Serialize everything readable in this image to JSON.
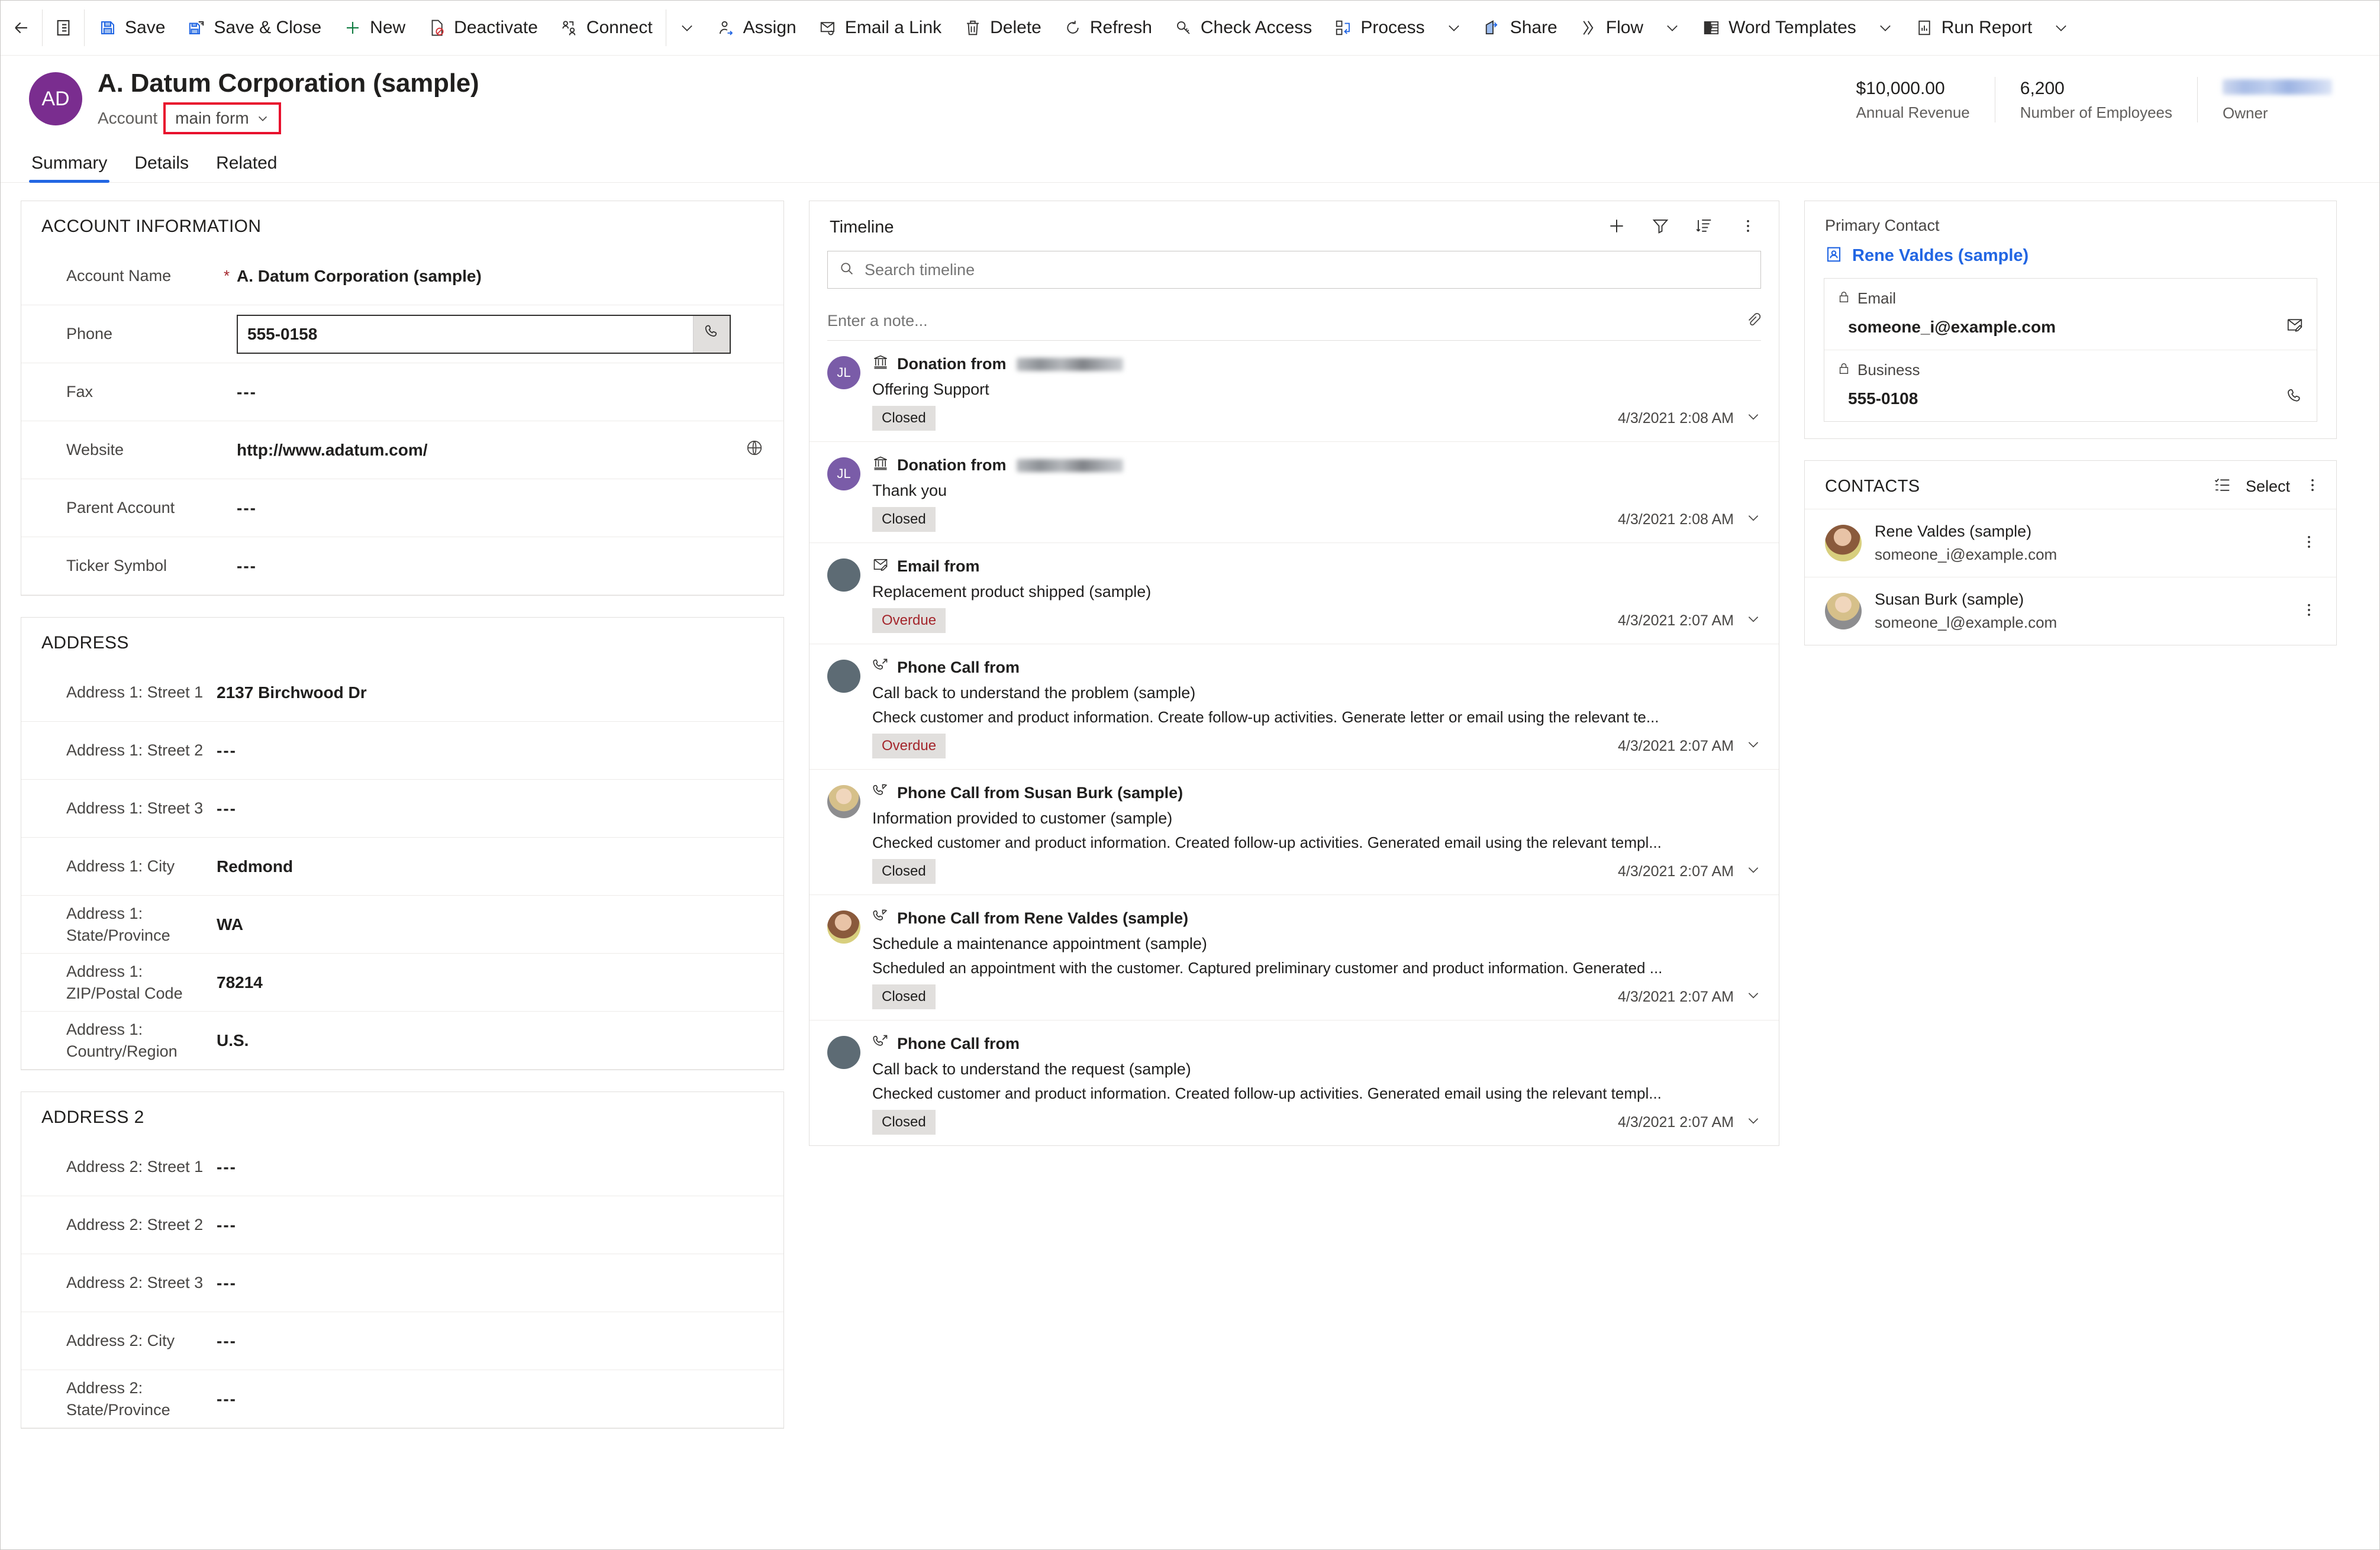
{
  "command_bar": {
    "back_label": "",
    "form_icon_label": "",
    "buttons": [
      {
        "label": "Save",
        "icon": "save-icon"
      },
      {
        "label": "Save & Close",
        "icon": "save-and-close-icon"
      },
      {
        "label": "New",
        "icon": "plus-icon"
      },
      {
        "label": "Deactivate",
        "icon": "deactivate-icon"
      },
      {
        "label": "Connect",
        "icon": "connect-icon",
        "chevron": true
      },
      {
        "label": "Assign",
        "icon": "assign-icon"
      },
      {
        "label": "Email a Link",
        "icon": "email-link-icon"
      },
      {
        "label": "Delete",
        "icon": "trash-icon"
      },
      {
        "label": "Refresh",
        "icon": "refresh-icon"
      },
      {
        "label": "Check Access",
        "icon": "key-icon"
      },
      {
        "label": "Process",
        "icon": "process-icon",
        "chevron": true
      },
      {
        "label": "Share",
        "icon": "share-icon"
      },
      {
        "label": "Flow",
        "icon": "flow-icon",
        "chevron": true
      },
      {
        "label": "Word Templates",
        "icon": "word-icon",
        "chevron": true
      },
      {
        "label": "Run Report",
        "icon": "report-icon",
        "chevron": true
      }
    ]
  },
  "header": {
    "avatar_initials": "AD",
    "title": "A. Datum Corporation (sample)",
    "entity_label": "Account",
    "form_selector": "main form",
    "highlight_color": "#E8112D",
    "metrics": [
      {
        "value": "$10,000.00",
        "label": "Annual Revenue"
      },
      {
        "value": "6,200",
        "label": "Number of Employees"
      },
      {
        "value": "",
        "label": "Owner",
        "redacted": true
      }
    ],
    "tabs": [
      {
        "label": "Summary",
        "active": true
      },
      {
        "label": "Details",
        "active": false
      },
      {
        "label": "Related",
        "active": false
      }
    ]
  },
  "account_information": {
    "title": "ACCOUNT INFORMATION",
    "fields": [
      {
        "label": "Account Name",
        "value": "A. Datum Corporation (sample)",
        "required": true
      },
      {
        "label": "Phone",
        "value": "555-0158",
        "focused": true,
        "trail_icon": "phone-icon"
      },
      {
        "label": "Fax",
        "value": "---"
      },
      {
        "label": "Website",
        "value": "http://www.adatum.com/",
        "trail_icon": "globe-icon"
      },
      {
        "label": "Parent Account",
        "value": "---"
      },
      {
        "label": "Ticker Symbol",
        "value": "---"
      }
    ]
  },
  "address_1": {
    "title": "ADDRESS",
    "fields": [
      {
        "label": "Address 1: Street 1",
        "value": "2137 Birchwood Dr"
      },
      {
        "label": "Address 1: Street 2",
        "value": "---"
      },
      {
        "label": "Address 1: Street 3",
        "value": "---"
      },
      {
        "label": "Address 1: City",
        "value": "Redmond"
      },
      {
        "label": "Address 1: State/Province",
        "value": "WA"
      },
      {
        "label": "Address 1: ZIP/Postal Code",
        "value": "78214"
      },
      {
        "label": "Address 1: Country/Region",
        "value": "U.S."
      }
    ]
  },
  "address_2": {
    "title": "ADDRESS 2",
    "fields": [
      {
        "label": "Address 2: Street 1",
        "value": "---"
      },
      {
        "label": "Address 2: Street 2",
        "value": "---"
      },
      {
        "label": "Address 2: Street 3",
        "value": "---"
      },
      {
        "label": "Address 2: City",
        "value": "---"
      },
      {
        "label": "Address 2: State/Province",
        "value": "---"
      }
    ]
  },
  "timeline": {
    "title": "Timeline",
    "search_placeholder": "Search timeline",
    "note_placeholder": "Enter a note...",
    "actions": [
      {
        "name": "add-timeline-record",
        "icon": "plus-icon"
      },
      {
        "name": "filter-timeline",
        "icon": "funnel-icon"
      },
      {
        "name": "sort-timeline",
        "icon": "sort-icon"
      },
      {
        "name": "timeline-more",
        "icon": "more-vertical-icon"
      }
    ],
    "items": [
      {
        "icon": "bank-icon",
        "title_prefix": "Donation from",
        "title_name_redacted": true,
        "avatar": "initials",
        "avatar_initials": "JL",
        "subject": "Offering Support",
        "description": "",
        "status": "Closed",
        "status_kind": "closed",
        "date": "4/3/2021 2:08 AM"
      },
      {
        "icon": "bank-icon",
        "title_prefix": "Donation from",
        "title_name_redacted": true,
        "avatar": "initials",
        "avatar_initials": "JL",
        "subject": "Thank you",
        "description": "",
        "status": "Closed",
        "status_kind": "closed",
        "date": "4/3/2021 2:08 AM"
      },
      {
        "icon": "email-icon",
        "title_prefix": "Email from",
        "title_name_redacted": false,
        "avatar": "slate",
        "avatar_initials": "",
        "subject": "Replacement product shipped (sample)",
        "description": "",
        "status": "Overdue",
        "status_kind": "overdue",
        "date": "4/3/2021 2:07 AM"
      },
      {
        "icon": "phone-outgoing-icon",
        "title_prefix": "Phone Call from",
        "title_name_redacted": false,
        "avatar": "slate",
        "avatar_initials": "",
        "subject": "Call back to understand the problem (sample)",
        "description": "Check customer and product information. Create follow-up activities. Generate letter or email using the relevant te...",
        "status": "Overdue",
        "status_kind": "overdue",
        "date": "4/3/2021 2:07 AM"
      },
      {
        "icon": "phone-incoming-icon",
        "title_prefix": "Phone Call from Susan Burk (sample)",
        "title_name_redacted": false,
        "avatar": "photo2",
        "avatar_initials": "",
        "subject": "Information provided to customer (sample)",
        "description": "Checked customer and product information. Created follow-up activities. Generated email using the relevant templ...",
        "status": "Closed",
        "status_kind": "closed",
        "date": "4/3/2021 2:07 AM"
      },
      {
        "icon": "phone-incoming-icon",
        "title_prefix": "Phone Call from Rene Valdes (sample)",
        "title_name_redacted": false,
        "avatar": "photo1",
        "avatar_initials": "",
        "subject": "Schedule a maintenance appointment (sample)",
        "description": "Scheduled an appointment with the customer. Captured preliminary customer and product information. Generated ...",
        "status": "Closed",
        "status_kind": "closed",
        "date": "4/3/2021 2:07 AM"
      },
      {
        "icon": "phone-outgoing-icon",
        "title_prefix": "Phone Call from",
        "title_name_redacted": false,
        "avatar": "slate",
        "avatar_initials": "",
        "subject": "Call back to understand the request (sample)",
        "description": "Checked customer and product information. Created follow-up activities. Generated email using the relevant templ...",
        "status": "Closed",
        "status_kind": "closed",
        "date": "4/3/2021 2:07 AM"
      }
    ]
  },
  "primary_contact": {
    "label": "Primary Contact",
    "name": "Rene Valdes (sample)",
    "link_color": "#2266E3",
    "fields": [
      {
        "label": "Email",
        "value": "someone_i@example.com",
        "lock": true,
        "trail_icon": "email-icon"
      },
      {
        "label": "Business",
        "value": "555-0108",
        "lock": true,
        "trail_icon": "phone-icon"
      }
    ]
  },
  "contacts": {
    "title": "CONTACTS",
    "select_label": "Select",
    "rows": [
      {
        "name": "Rene Valdes (sample)",
        "email": "someone_i@example.com",
        "avatar": "a1"
      },
      {
        "name": "Susan Burk (sample)",
        "email": "someone_l@example.com",
        "avatar": "a2"
      }
    ]
  }
}
